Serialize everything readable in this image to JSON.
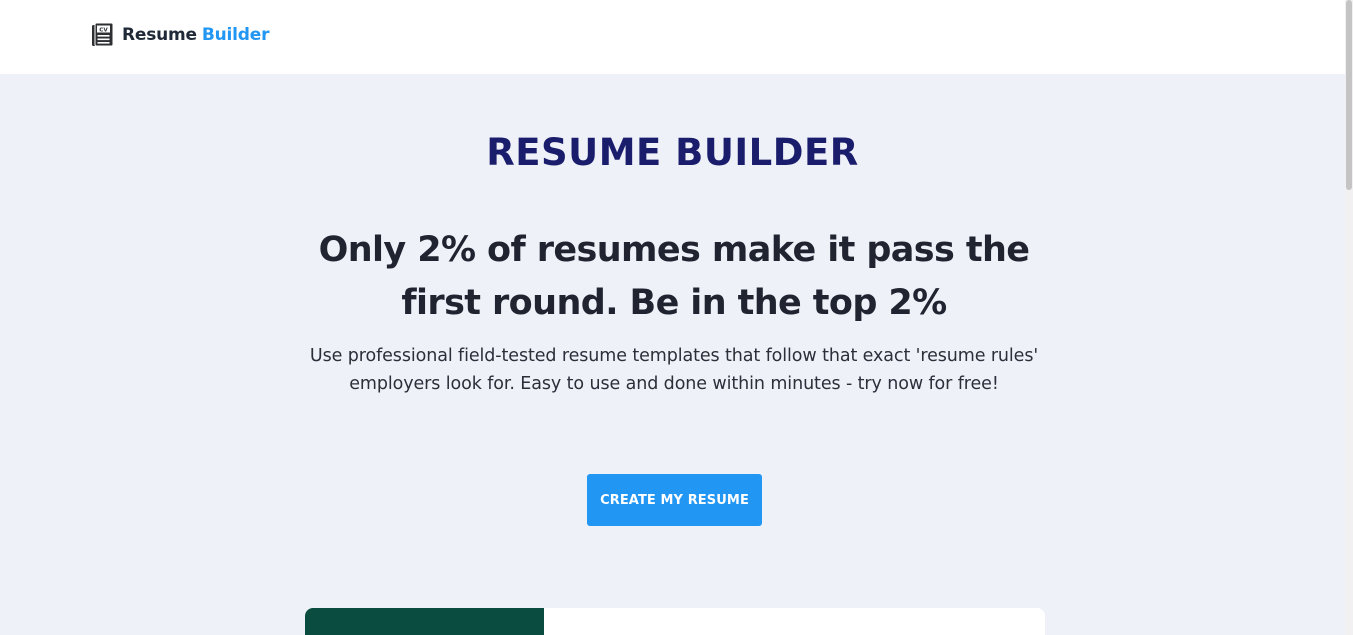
{
  "navbar": {
    "brand_part1": "Resume",
    "brand_part2": "Builder",
    "logo_icon": "cv-document-icon"
  },
  "hero": {
    "title": "RESUME BUILDER",
    "headline": "Only 2% of resumes make it pass the first round. Be in the top 2%",
    "subtitle": "Use professional field-tested resume templates that follow that exact 'resume rules' employers look for. Easy to use and done within minutes - try now for free!",
    "cta_label": "CREATE MY RESUME"
  },
  "colors": {
    "accent": "#2196f3",
    "title": "#1a1d6b",
    "headline": "#1f2430",
    "background": "#eef1f8",
    "preview_dark": "#0a4d40"
  }
}
